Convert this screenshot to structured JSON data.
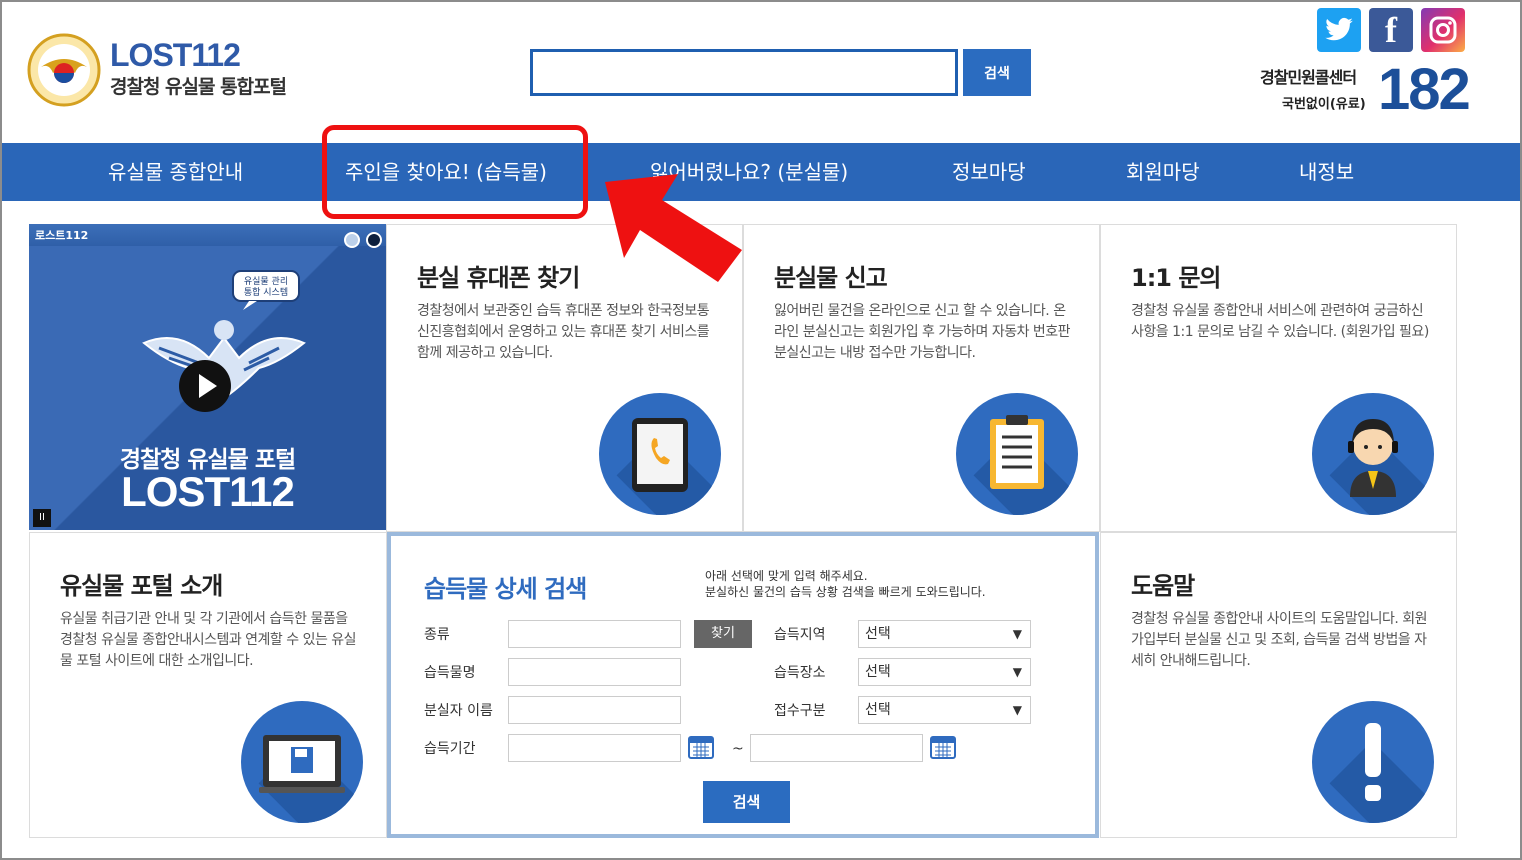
{
  "header": {
    "logo_title": "LOST112",
    "logo_subtitle": "경찰청 유실물 통합포털",
    "search_value": "",
    "search_button": "검색",
    "call_label": "경찰민원콜센터",
    "call_sub": "국번없이(유료)",
    "call_number": "182"
  },
  "nav": {
    "items": [
      {
        "label": "유실물 종합안내"
      },
      {
        "label": "주인을 찾아요! (습득물)"
      },
      {
        "label": "잃어버렸나요? (분실물)"
      },
      {
        "label": "정보마당"
      },
      {
        "label": "회원마당"
      },
      {
        "label": "내정보"
      }
    ]
  },
  "video": {
    "tag": "로스트112",
    "title1": "경찰청 유실물 포털",
    "title2": "LOST112",
    "bubble": "유실물 관리 통합 시스템",
    "pause": "II"
  },
  "cards": {
    "phone": {
      "title": "분실 휴대폰 찾기",
      "text": "경찰청에서 보관중인 습득 휴대폰 정보와 한국정보통신진흥협회에서 운영하고 있는 휴대폰 찾기 서비스를 함께 제공하고 있습니다."
    },
    "report": {
      "title": "분실물 신고",
      "text": "잃어버린 물건을 온라인으로 신고 할 수 있습니다. 온라인 분실신고는 회원가입 후 가능하며 자동차 번호판 분실신고는 내방 접수만 가능합니다."
    },
    "qna": {
      "title": "1:1 문의",
      "text": "경찰청 유실물 종합안내 서비스에 관련하여 궁금하신 사항을 1:1 문의로 남길 수 있습니다. (회원가입 필요)"
    },
    "intro": {
      "title": "유실물 포털 소개",
      "text": "유실물 취급기관 안내 및 각 기관에서 습득한 물품을 경찰청 유실물 종합안내시스템과 연계할 수 있는 유실물 포털 사이트에 대한 소개입니다."
    },
    "help": {
      "title": "도움말",
      "text": "경찰청 유실물 종합안내 사이트의 도움말입니다. 회원가입부터 분실물 신고 및 조회, 습득물 검색 방법을 자세히 안내해드립니다."
    }
  },
  "search_form": {
    "title": "습득물 상세 검색",
    "note1": "아래 선택에 맞게 입력 해주세요.",
    "note2": "분실하신 물건의 습득 상황 검색을 빠르게 도와드립니다.",
    "label_type": "종류",
    "find_button": "찾기",
    "label_name": "습득물명",
    "label_owner": "분실자 이름",
    "label_period": "습득기간",
    "tilde": "~",
    "label_region": "습득지역",
    "label_place": "습득장소",
    "label_category": "접수구분",
    "select_region": "선택",
    "select_place": "선택",
    "select_category": "선택",
    "search_button": "검색"
  },
  "colors": {
    "brand_blue": "#2a66b8",
    "highlight_red": "#ee1111"
  },
  "icons": [
    "twitter-icon",
    "facebook-icon",
    "instagram-icon",
    "police-emblem-icon",
    "play-icon",
    "tablet-phone-icon",
    "clipboard-icon",
    "operator-icon",
    "monitor-icon",
    "exclamation-icon",
    "calendar-icon"
  ]
}
